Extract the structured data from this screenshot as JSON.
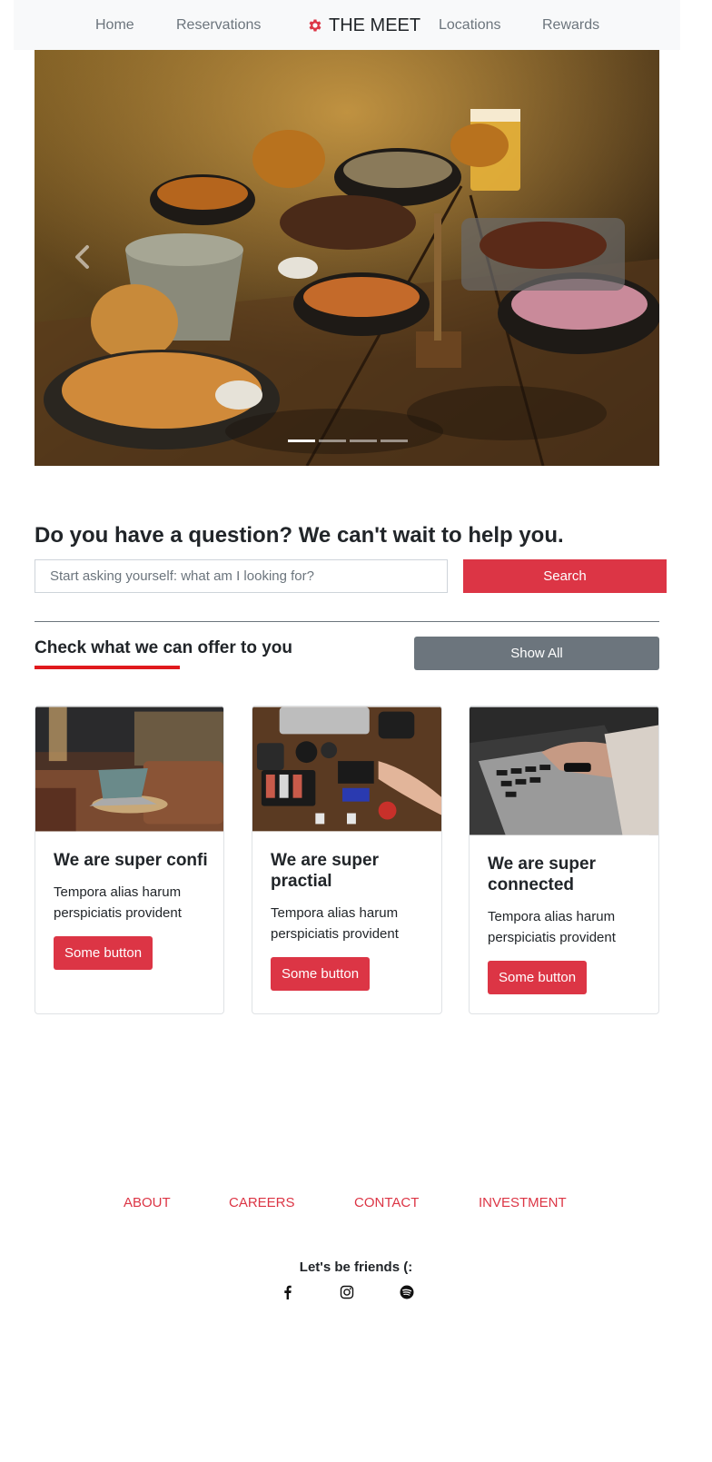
{
  "nav": {
    "links": [
      "Home",
      "Reservations",
      "Locations",
      "Rewards"
    ],
    "brand": "THE MEET",
    "brand_icon": "gear-icon",
    "accent": "#dc3545"
  },
  "hero": {
    "prev_icon": "chevron-left-icon",
    "slide_count": 4,
    "active_slide": 1
  },
  "search": {
    "heading": "Do you have a question? We can't wait to help you.",
    "placeholder": "Start asking yourself: what am I looking for?",
    "button": "Search"
  },
  "offers": {
    "heading": "Check what we can offer to you",
    "show_all": "Show All"
  },
  "cards": [
    {
      "title": "We are super confi",
      "text": "Tempora alias harum perspiciatis provident",
      "button": "Some button"
    },
    {
      "title": "We are super practial",
      "text": "Tempora alias harum perspiciatis provident",
      "button": "Some button"
    },
    {
      "title": "We are super connected",
      "text": "Tempora alias harum perspiciatis provident",
      "button": "Some button"
    }
  ],
  "footer": {
    "links": [
      "ABOUT",
      "CAREERS",
      "CONTACT",
      "INVESTMENT"
    ],
    "friends": "Let's be friends (:",
    "social_icons": [
      "facebook-icon",
      "instagram-icon",
      "spotify-icon"
    ]
  },
  "colors": {
    "primary": "#dc3545",
    "secondary": "#6c757d",
    "nav_bg": "#f8f9fa",
    "underline": "#e0191d"
  }
}
